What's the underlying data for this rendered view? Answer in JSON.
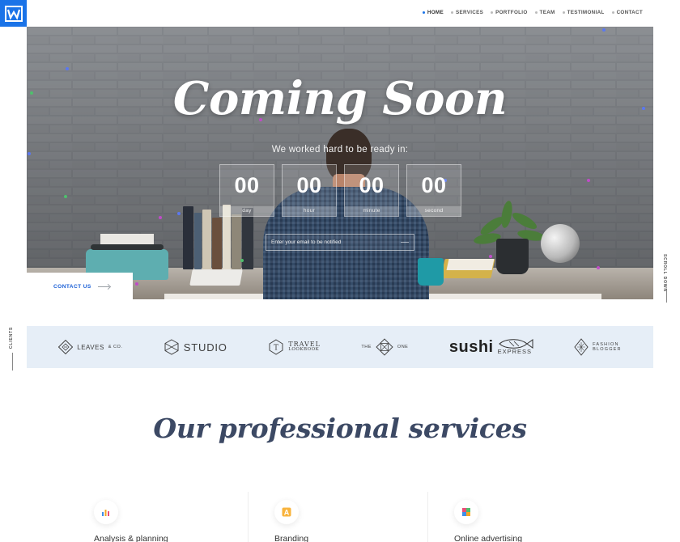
{
  "brand": {
    "logo_icon": "w-logo-icon",
    "accent": "#1a73e8"
  },
  "nav": {
    "items": [
      {
        "label": "HOME",
        "active": true
      },
      {
        "label": "SERVICES",
        "active": false
      },
      {
        "label": "PORTFOLIO",
        "active": false
      },
      {
        "label": "TEAM",
        "active": false
      },
      {
        "label": "TESTIMONIAL",
        "active": false
      },
      {
        "label": "CONTACT",
        "active": false
      }
    ]
  },
  "hero": {
    "title": "Coming Soon",
    "subtitle": "We worked hard to be ready in:",
    "countdown": [
      {
        "value": "00",
        "label": "day"
      },
      {
        "value": "00",
        "label": "hour"
      },
      {
        "value": "00",
        "label": "minute"
      },
      {
        "value": "00",
        "label": "second"
      }
    ],
    "email_placeholder": "Enter your email to be notified"
  },
  "contact_tab": {
    "label": "CONTACT US"
  },
  "scroll_down": {
    "label": "SCROLL DOWN"
  },
  "clients": {
    "label": "CLIENTS",
    "logos": [
      {
        "name": "LEAVES",
        "suffix": "& CO."
      },
      {
        "name": "STUDIO"
      },
      {
        "name": "TRAVEL",
        "subname": "LOOKBOOK"
      },
      {
        "name": "THE",
        "suffix": "ONE"
      },
      {
        "name": "sushi",
        "subname": "EXPRESS"
      },
      {
        "name": "FASHION",
        "subname": "BLOGGER"
      }
    ]
  },
  "services": {
    "title": "Our professional services",
    "items": [
      {
        "label": "Analysis & planning",
        "icon": "bar-chart-icon"
      },
      {
        "label": "Branding",
        "icon": "letter-a-icon"
      },
      {
        "label": "Online advertising",
        "icon": "puzzle-icon"
      }
    ]
  }
}
